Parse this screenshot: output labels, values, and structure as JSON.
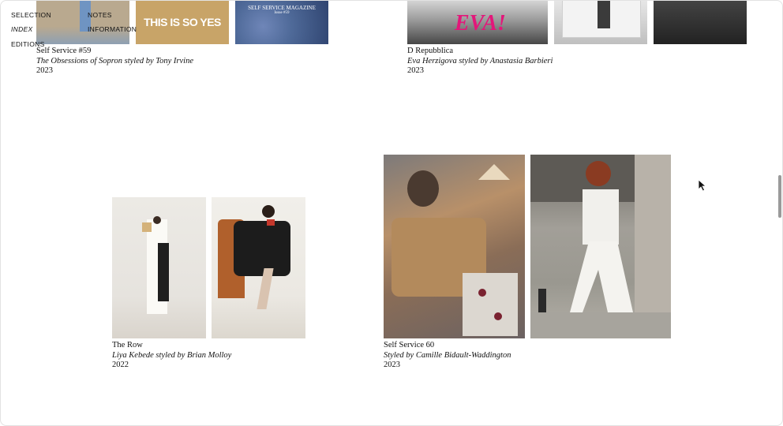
{
  "nav": {
    "selection": "SELECTION",
    "index": "INDEX",
    "editions": "EDITIONS",
    "notes": "NOTES",
    "information": "INFORMATION"
  },
  "projects": [
    {
      "title": "Self Service #59",
      "credit": "The Obsessions of Sopron styled by Tony Irvine",
      "year": "2023",
      "image_texts": [
        "THIS IS SO YES",
        "SELF SERVICE MAGAZINE",
        "Issue #59"
      ]
    },
    {
      "title": "D Repubblica",
      "credit": "Eva Herzigova styled by Anastasia Barbieri",
      "year": "2023",
      "image_texts": [
        "EVA!"
      ]
    },
    {
      "title": "The Row",
      "credit": "Liya Kebede styled by Brian Molloy",
      "year": "2022"
    },
    {
      "title": "Self Service 60",
      "credit": "Styled by Camille Bidault-Waddington",
      "year": "2023"
    }
  ],
  "colors": {
    "background": "#ffffff",
    "text": "#111111",
    "magazine_accent": "#e3177a"
  },
  "icons": [
    "mouse-cursor-icon"
  ]
}
